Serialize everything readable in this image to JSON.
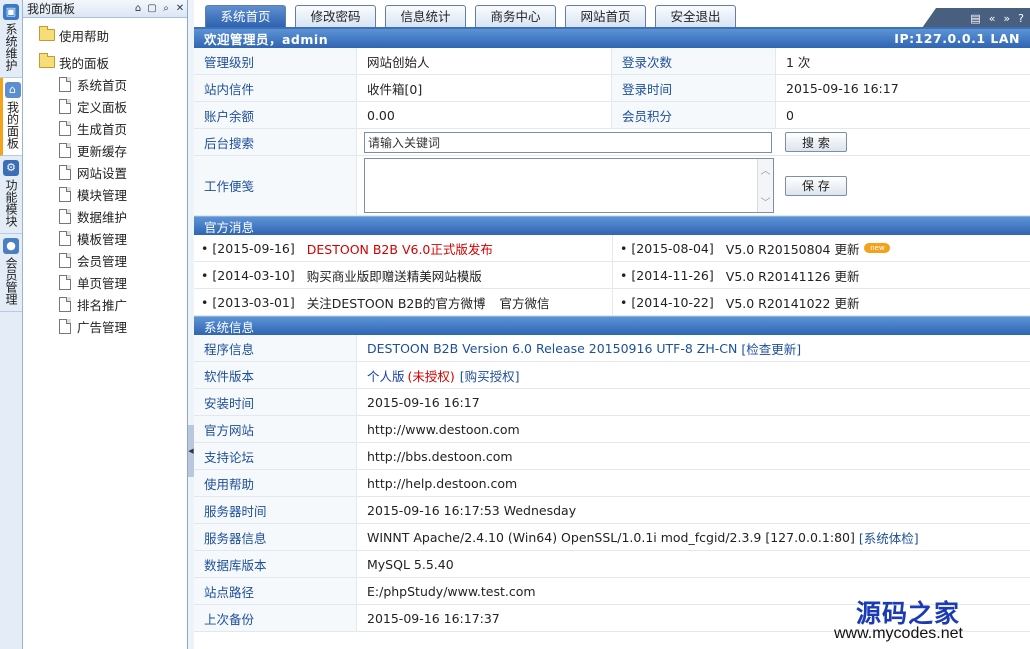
{
  "vtabs": [
    {
      "label": "系统维护",
      "icon": "computer-icon",
      "color": "#3a78c8"
    },
    {
      "label": "我的面板",
      "icon": "home-icon",
      "color": "#5b8fd0",
      "active": true
    },
    {
      "label": "功能模块",
      "icon": "modules-icon",
      "color": "#3a6fb8"
    },
    {
      "label": "会员管理",
      "icon": "user-icon",
      "color": "#4c7fc2"
    }
  ],
  "sidebar": {
    "title": "我的面板",
    "folders": [
      {
        "label": "使用帮助"
      },
      {
        "label": "我的面板"
      }
    ],
    "items": [
      "系统首页",
      "定义面板",
      "生成首页",
      "更新缓存",
      "网站设置",
      "模块管理",
      "数据维护",
      "模板管理",
      "会员管理",
      "单页管理",
      "排名推广",
      "广告管理"
    ]
  },
  "tabs": [
    "系统首页",
    "修改密码",
    "信息统计",
    "商务中心",
    "网站首页",
    "安全退出"
  ],
  "header": {
    "welcome": "欢迎管理员，admin",
    "ip": "IP:127.0.0.1 LAN"
  },
  "info": {
    "admin_level_label": "管理级别",
    "admin_level": "网站创始人",
    "login_count_label": "登录次数",
    "login_count": "1 次",
    "inbox_label": "站内信件",
    "inbox": "收件箱[0]",
    "login_time_label": "登录时间",
    "login_time": "2015-09-16 16:17",
    "balance_label": "账户余额",
    "balance": "0.00",
    "points_label": "会员积分",
    "points": "0",
    "search_label": "后台搜索",
    "search_placeholder": "请输入关键词",
    "search_button": "搜 索",
    "memo_label": "工作便笺",
    "save_button": "保 存"
  },
  "news": {
    "title": "官方消息",
    "left": [
      {
        "date": "[2015-09-16]",
        "text": "DESTOON B2B V6.0正式版发布",
        "hot": true
      },
      {
        "date": "[2014-03-10]",
        "text": "购买商业版即赠送精美网站模版"
      },
      {
        "date": "[2013-03-01]",
        "text": "关注DESTOON B2B的官方微博",
        "extra": "官方微信"
      }
    ],
    "right": [
      {
        "date": "[2015-08-04]",
        "text": "V5.0 R20150804 更新",
        "badge": "new"
      },
      {
        "date": "[2014-11-26]",
        "text": "V5.0 R20141126 更新"
      },
      {
        "date": "[2014-10-22]",
        "text": "V5.0 R20141022 更新"
      }
    ]
  },
  "system": {
    "title": "系统信息",
    "program_label": "程序信息",
    "program": "DESTOON B2B Version 6.0 Release 20150916 UTF-8 ZH-CN",
    "check_update": "[检查更新]",
    "edition_label": "软件版本",
    "edition": "个人版",
    "unauthorized": "(未授权)",
    "buy": "[购买授权]",
    "install_label": "安装时间",
    "install": "2015-09-16 16:17",
    "site_label": "官方网站",
    "site": "http://www.destoon.com",
    "bbs_label": "支持论坛",
    "bbs": "http://bbs.destoon.com",
    "help_label": "使用帮助",
    "help": "http://help.destoon.com",
    "server_time_label": "服务器时间",
    "server_time": "2015-09-16 16:17:53 Wednesday",
    "server_info_label": "服务器信息",
    "server_info": "WINNT Apache/2.4.10 (Win64) OpenSSL/1.0.1i mod_fcgid/2.3.9 [127.0.0.1:80]",
    "system_check": "[系统体检]",
    "db_label": "数据库版本",
    "db": "MySQL 5.5.40",
    "path_label": "站点路径",
    "path": "E:/phpStudy/www.test.com",
    "backup_label": "上次备份",
    "backup": "2015-09-16 16:17:37"
  },
  "watermark": {
    "cn": "源码之家",
    "en": "www.mycodes.net"
  }
}
